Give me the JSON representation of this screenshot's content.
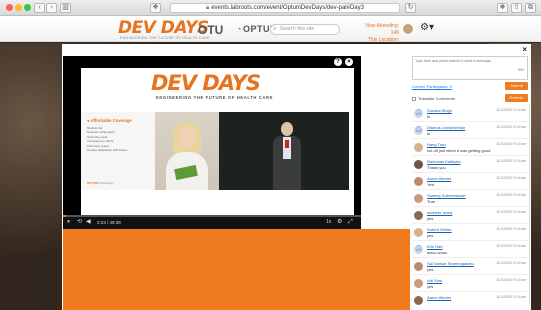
{
  "browser": {
    "url": "events.labroots.com/event/OptumDevDays/dev-pal#Day3",
    "nav_back": "‹",
    "nav_fwd": "›",
    "sidebar_btn": "▥",
    "reload_btn": "↻",
    "share_btn": "⇧",
    "tabs_btn": "⧉",
    "ext_btn": "❖"
  },
  "header": {
    "brand_main": "DEV DAYS",
    "brand_sub": "ENGINEERING THE FUTURE OF HEALTH CARE",
    "otu": "OTU",
    "optum": "OPTUM",
    "search_placeholder": "Search this site",
    "attend_line1": "Now Attending: 146",
    "attend_line2": "This Location: 15"
  },
  "modal": {
    "close": "×",
    "player": {
      "help": "?",
      "close": "×",
      "time": "0:23 / 49:39",
      "progress_fraction": 0.01,
      "rate": "1x",
      "controls": {
        "play": "⏸",
        "loop": "⟲",
        "volume": "◀",
        "settings": "⚙",
        "fullscreen": "⤢"
      }
    },
    "slide": {
      "title": "DEV DAYS",
      "tagline": "ENGINEERING THE FUTURE OF HEALTH CARE",
      "panel_title": "Affordable Coverage",
      "bullets": [
        "Medical risk",
        "Network configuration",
        "Operating costs",
        "Transparency efforts",
        "Pharmacy spend",
        "Greater satisfaction with fitness"
      ],
      "footer_brand": "OPTUM",
      "footer_text": "Technology"
    },
    "chat": {
      "input_placeholder": "Type here and press submit to send a message.",
      "char_count": "500",
      "participants_link": "Current Participants: 9",
      "submit_label": "Submit",
      "transcript_label": "Translate Comments",
      "refresh_label": "Refresh",
      "messages": [
        {
          "name": "Suzana Singh",
          "text": "hi",
          "time": "11/11/2020 07:44 am",
          "avatar": "initial"
        },
        {
          "name": "Dhanus Unnikrishnan",
          "text": "hi",
          "time": "11/11/2020 07:44 am",
          "avatar": "initial"
        },
        {
          "name": "Hang Tran",
          "text": "cut off just when it was getting good",
          "time": "11/11/2020 07:44 am",
          "avatar": "photo"
        },
        {
          "name": "Ramunas Kadlyala",
          "text": "Thank you",
          "time": "11/11/2020 07:44 am",
          "avatar": "photo"
        },
        {
          "name": "Aaron Wexler",
          "text": "Yes!",
          "time": "11/11/2020 07:44 am",
          "avatar": "photo"
        },
        {
          "name": "Sudeep Subramanian",
          "text": "True",
          "time": "11/11/2020 07:44 am",
          "avatar": "photo"
        },
        {
          "name": "sudheer asma",
          "text": "yes",
          "time": "11/11/2020 07:44 am",
          "avatar": "photo"
        },
        {
          "name": "Robert Winter",
          "text": "yes",
          "time": "11/11/2020 07:44 am",
          "avatar": "photo"
        },
        {
          "name": "Eric Hart",
          "text": "wooo wooo",
          "time": "11/11/2020 07:44 am",
          "avatar": "initial"
        },
        {
          "name": "Sai Sankar Sharmugasetu",
          "text": "yes",
          "time": "11/11/2020 07:44 am",
          "avatar": "photo"
        },
        {
          "name": "Arti Soni",
          "text": "yes",
          "time": "11/11/2020 07:44 am",
          "avatar": "photo"
        },
        {
          "name": "Aaron Wexler",
          "text": "",
          "time": "11/11/2020 07:44 am",
          "avatar": "photo"
        }
      ]
    }
  },
  "colors": {
    "brand_orange": "#f07b1e",
    "link_blue": "#1a5fb4"
  }
}
